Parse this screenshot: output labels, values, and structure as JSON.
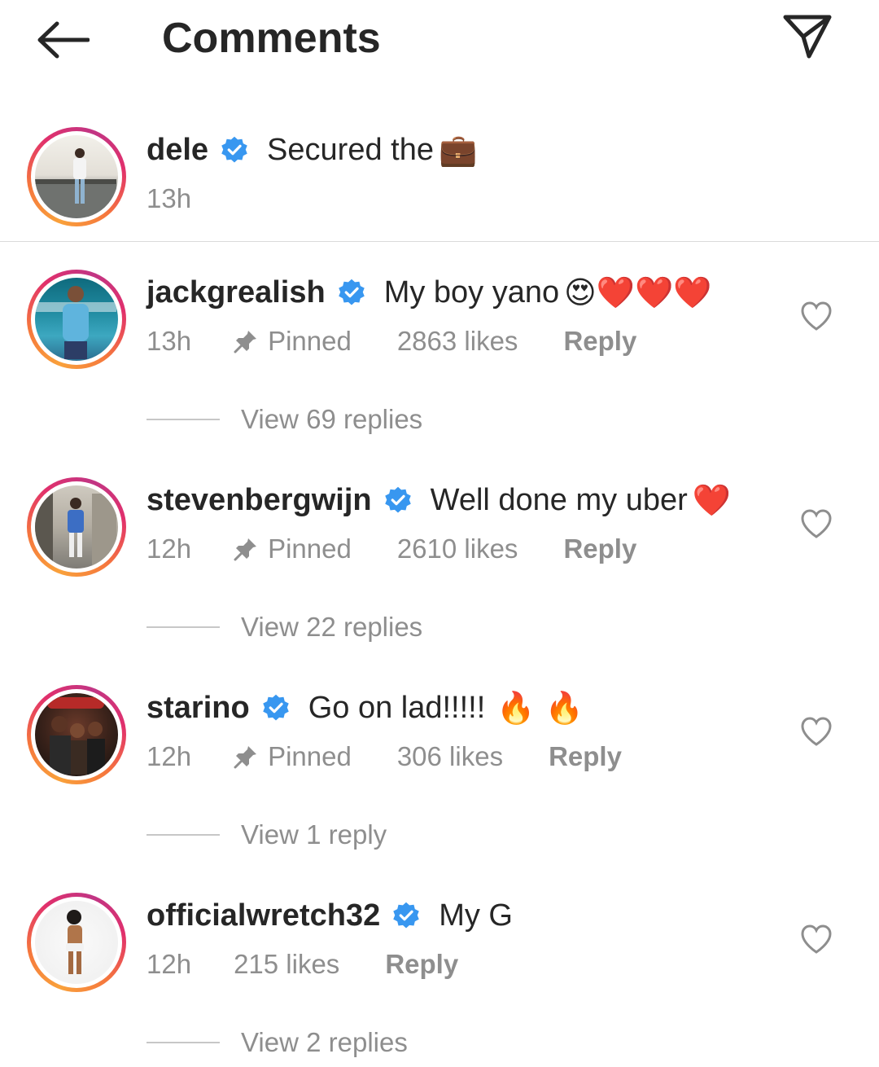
{
  "header": {
    "title": "Comments",
    "back_icon": "arrow-left-icon",
    "share_icon": "paper-plane-icon"
  },
  "caption": {
    "username": "dele",
    "text": "Secured the",
    "emoji": "💼",
    "time": "13h"
  },
  "comments": [
    {
      "username": "jackgrealish",
      "text": "My boy yano",
      "emoji": "😍❤️❤️❤️",
      "time": "13h",
      "pinned": "Pinned",
      "likes": "2863 likes",
      "reply": "Reply",
      "view_replies": "View 69 replies"
    },
    {
      "username": "stevenbergwijn",
      "text": "Well done my uber",
      "emoji": "❤️",
      "time": "12h",
      "pinned": "Pinned",
      "likes": "2610 likes",
      "reply": "Reply",
      "view_replies": "View 22 replies"
    },
    {
      "username": "starino",
      "text": "Go on lad!!!!!",
      "emoji": "🔥 🔥",
      "time": "12h",
      "pinned": "Pinned",
      "likes": "306 likes",
      "reply": "Reply",
      "view_replies": "View 1 reply"
    },
    {
      "username": "officialwretch32",
      "text": "My G",
      "emoji": "",
      "time": "12h",
      "likes": "215 likes",
      "reply": "Reply",
      "view_replies": "View 2 replies"
    }
  ],
  "colors": {
    "verified": "#3897f0",
    "text_primary": "#262626",
    "text_secondary": "#8e8e8e",
    "divider": "#dbdbdb"
  }
}
